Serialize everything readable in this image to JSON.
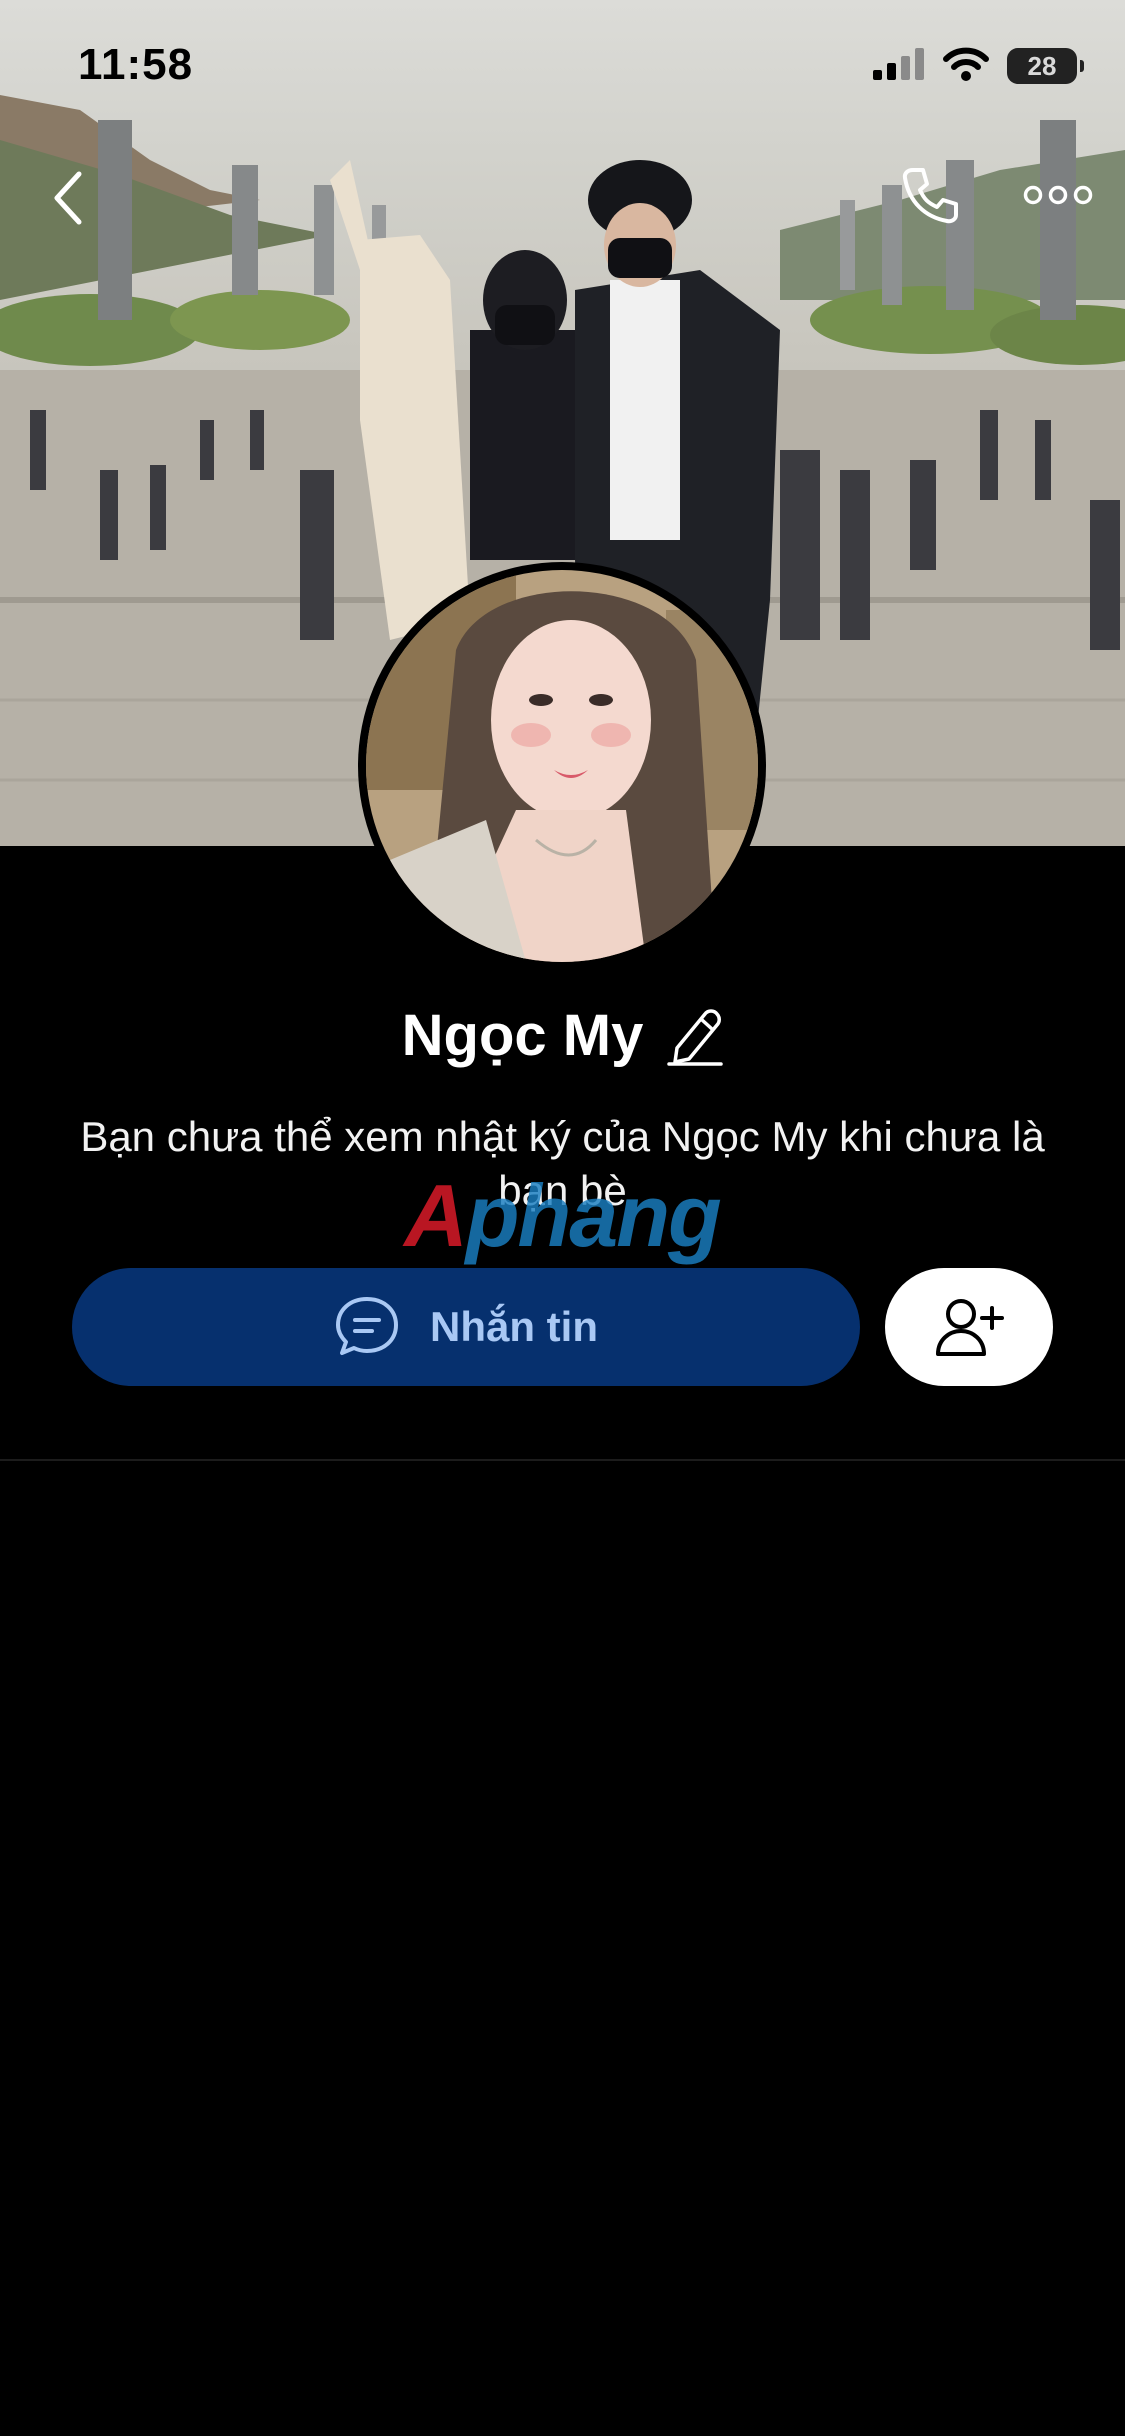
{
  "status_bar": {
    "time": "11:58",
    "battery_level": "28",
    "icons": [
      "cellular-signal-icon",
      "wifi-icon",
      "battery-icon"
    ]
  },
  "navigation": {
    "back_icon": "chevron-left-icon",
    "call_icon": "phone-icon",
    "more_icon": "more-horizontal-icon"
  },
  "profile": {
    "name": "Ngọc My",
    "edit_icon": "pencil-icon",
    "notice": "Bạn chưa thể xem nhật ký của Ngọc My khi chưa là bạn bè"
  },
  "watermark": {
    "text_part1": "A",
    "text_part2": "phang"
  },
  "actions": {
    "message_label": "Nhắn tin",
    "message_icon": "chat-bubble-icon",
    "add_friend_icon": "add-friend-icon"
  },
  "colors": {
    "background": "#000000",
    "message_button_bg": "#06306e",
    "message_button_text": "#a9c8f4",
    "add_friend_button_bg": "#ffffff"
  }
}
